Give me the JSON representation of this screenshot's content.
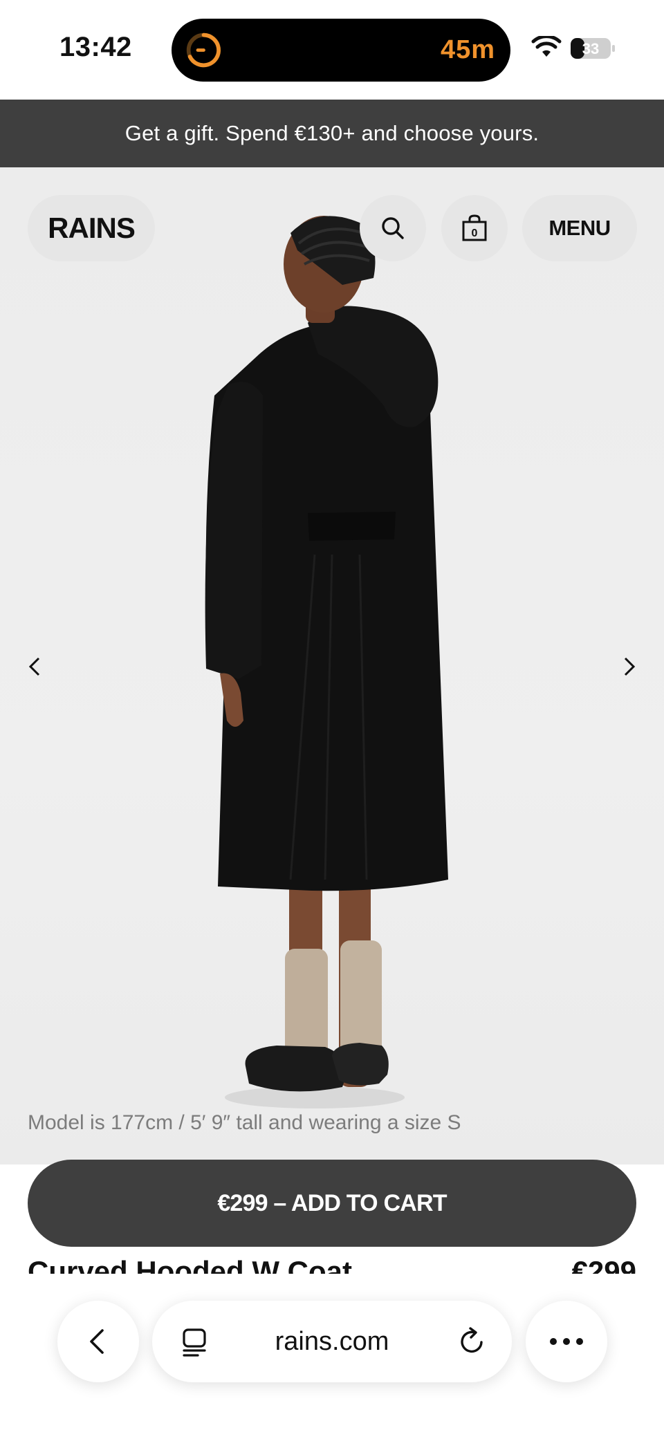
{
  "status_bar": {
    "time": "13:42",
    "live_activity_timer": "45m",
    "battery_level": "33"
  },
  "promo": {
    "text": "Get a gift. Spend €130+ and choose yours."
  },
  "header": {
    "logo": "RAINS",
    "cart_count": "0",
    "menu_label": "MENU"
  },
  "gallery": {
    "caption": "Model is 177cm / 5′ 9″ tall and wearing a size S"
  },
  "cta": {
    "add_to_cart_label": "€299 – ADD TO CART"
  },
  "product": {
    "title_partial": "Curved Hooded W Coat",
    "price_partial": "€299"
  },
  "browser": {
    "url": "rains.com"
  },
  "colors": {
    "banner_bg": "#3f3f3f",
    "hero_bg": "#ececec",
    "pill_bg": "#e6e6e6",
    "island_accent": "#f0922c"
  }
}
